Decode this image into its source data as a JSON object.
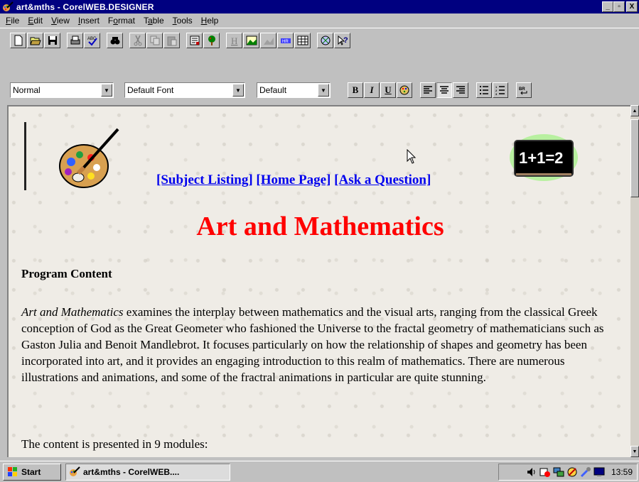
{
  "window": {
    "title": "art&mths - CorelWEB.DESIGNER",
    "min_glyph": "_",
    "max_glyph": "▫",
    "close_glyph": "X"
  },
  "menu": [
    {
      "label": "File",
      "key": "F",
      "rest": "ile"
    },
    {
      "label": "Edit",
      "key": "E",
      "rest": "dit"
    },
    {
      "label": "View",
      "key": "V",
      "rest": "iew"
    },
    {
      "label": "Insert",
      "key": "I",
      "rest": "nsert"
    },
    {
      "label": "Format",
      "key": "o",
      "pre": "F",
      "rest": "rmat"
    },
    {
      "label": "Table",
      "key": "a",
      "pre": "T",
      "rest": "ble"
    },
    {
      "label": "Tools",
      "key": "T",
      "rest": "ools"
    },
    {
      "label": "Help",
      "key": "H",
      "rest": "elp"
    }
  ],
  "format_bar": {
    "style_value": "Normal",
    "font_value": "Default Font",
    "size_value": "Default",
    "bold_label": "B",
    "italic_label": "I",
    "underline_label": "U"
  },
  "document": {
    "nav_links": [
      "[Subject Listing]",
      "[Home Page]",
      "[Ask a Question]"
    ],
    "title": "Art and Mathematics",
    "section_heading": "Program Content",
    "para_italic": "Art and Mathematics",
    "para_rest": " examines the interplay between mathematics and the visual arts, ranging from the classical Greek conception of God as the Great Geometer who fashioned the Universe to the fractal geometry of mathematicians such as Gaston Julia and Benoit Mandlebrot. It focuses particularly on how the relationship of shapes and geometry has been incorporated into art, and it provides an engaging introduction to this realm of mathematics. There are numerous illustrations and animations, and some of the fractral animations in particular are quite stunning.",
    "para2": "The content is presented in 9 modules:",
    "chalkboard_text": "1+1=2"
  },
  "taskbar": {
    "start_label": "Start",
    "task_label": "art&mths - CorelWEB....",
    "clock": "13:59"
  },
  "colors": {
    "titlebar": "#000080",
    "title_text": "#ff0000",
    "link": "#0000ee",
    "window_bg": "#c0c0c0"
  },
  "icons": [
    "app-icon",
    "new-icon",
    "open-icon",
    "save-icon",
    "print-icon",
    "spellcheck-icon",
    "find-icon",
    "cut-icon",
    "copy-icon",
    "paste-icon",
    "form-icon",
    "tree-icon",
    "heading-icon",
    "image-icon",
    "image-map-icon",
    "horizontal-rule-icon",
    "table-icon",
    "multimedia-icon",
    "context-help-icon",
    "palette-image",
    "chalkboard-image",
    "speaker-icon",
    "windows-logo-icon"
  ]
}
